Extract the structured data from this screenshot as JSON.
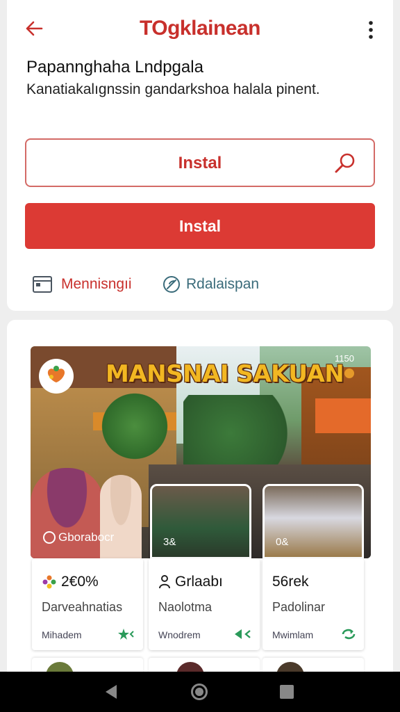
{
  "appbar": {
    "title": "TOgklainean"
  },
  "header": {
    "heading": "Papannghaha Lndpgala",
    "subtext": "Kanatiakalıgnssin gandarkshoa halala pinent."
  },
  "actions": {
    "install_outline_label": "Instal",
    "install_filled_label": "Instal",
    "link_left": "Mennisngıi",
    "link_right": "Rdalaispan"
  },
  "hero": {
    "title": "MANSNAI SAKUAN",
    "count": "1150",
    "caption": "Gborabocr",
    "thumb_a_label": "3&",
    "thumb_b_label": "0&"
  },
  "stats": [
    {
      "value": "2€0%",
      "label": "Darveahnatias",
      "footer": "Mihadem"
    },
    {
      "value": "Grlaabı",
      "label": "Naolotma",
      "footer": "Wnodrem"
    },
    {
      "value": "56rek",
      "label": "Padolinar",
      "footer": "Mwimlam"
    }
  ],
  "colors": {
    "accent": "#dc3a34",
    "title_red": "#c8302c",
    "link_teal": "#3a6b7a",
    "hero_title_gold": "#f2b722"
  }
}
